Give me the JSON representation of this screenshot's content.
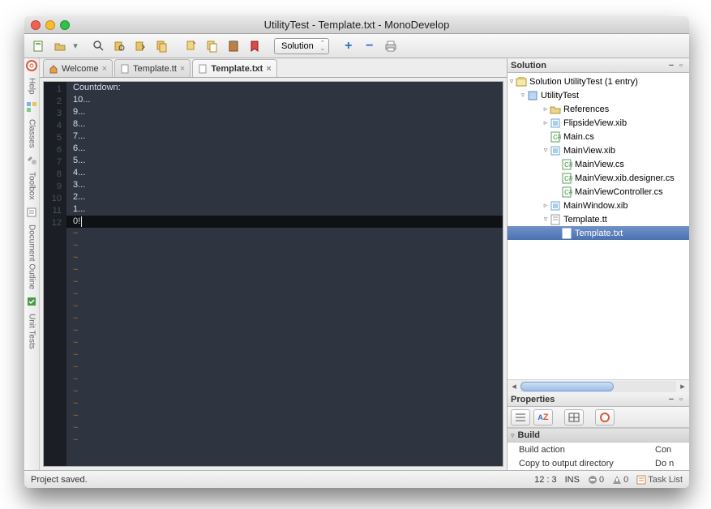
{
  "window": {
    "title": "UtilityTest - Template.txt - MonoDevelop"
  },
  "traffic": {
    "close": "#f55f51",
    "min": "#f9bc2f",
    "max": "#30c147"
  },
  "toolbar": {
    "solution_label": "Solution"
  },
  "left_tabs": [
    "Help",
    "Classes",
    "Toolbox",
    "Document Outline",
    "Unit Tests"
  ],
  "tabs": [
    {
      "label": "Welcome",
      "icon": "home",
      "active": false
    },
    {
      "label": "Template.tt",
      "icon": "file",
      "active": false
    },
    {
      "label": "Template.txt",
      "icon": "file",
      "active": true
    }
  ],
  "editor": {
    "lines": [
      "Countdown:",
      "10...",
      "9...",
      "8...",
      "7...",
      "6...",
      "5...",
      "4...",
      "3...",
      "2...",
      "1...",
      "0!"
    ],
    "tilde_count": 18,
    "current_line_index": 11
  },
  "solution_panel": {
    "title": "Solution",
    "root": "Solution UtilityTest (1 entry)",
    "project": "UtilityTest",
    "nodes": [
      {
        "label": "References",
        "depth": 3,
        "expander": "▹",
        "icon": "folder"
      },
      {
        "label": "FlipsideView.xib",
        "depth": 3,
        "expander": "▹",
        "icon": "xib"
      },
      {
        "label": "Main.cs",
        "depth": 3,
        "expander": "",
        "icon": "cs"
      },
      {
        "label": "MainView.xib",
        "depth": 3,
        "expander": "▿",
        "icon": "xib"
      },
      {
        "label": "MainView.cs",
        "depth": 4,
        "expander": "",
        "icon": "cs"
      },
      {
        "label": "MainView.xib.designer.cs",
        "depth": 4,
        "expander": "",
        "icon": "cs"
      },
      {
        "label": "MainViewController.cs",
        "depth": 4,
        "expander": "",
        "icon": "cs"
      },
      {
        "label": "MainWindow.xib",
        "depth": 3,
        "expander": "▹",
        "icon": "xib"
      },
      {
        "label": "Template.tt",
        "depth": 3,
        "expander": "▿",
        "icon": "tt"
      },
      {
        "label": "Template.txt",
        "depth": 4,
        "expander": "",
        "icon": "txt",
        "selected": true
      }
    ]
  },
  "properties_panel": {
    "title": "Properties",
    "group": "Build",
    "rows": [
      {
        "name": "Build action",
        "value": "Con"
      },
      {
        "name": "Copy to output directory",
        "value": "Do n"
      }
    ]
  },
  "status": {
    "message": "Project saved.",
    "cursor": "12 : 3",
    "mode": "INS",
    "errors": "0",
    "warnings": "0",
    "tasklist": "Task List"
  }
}
